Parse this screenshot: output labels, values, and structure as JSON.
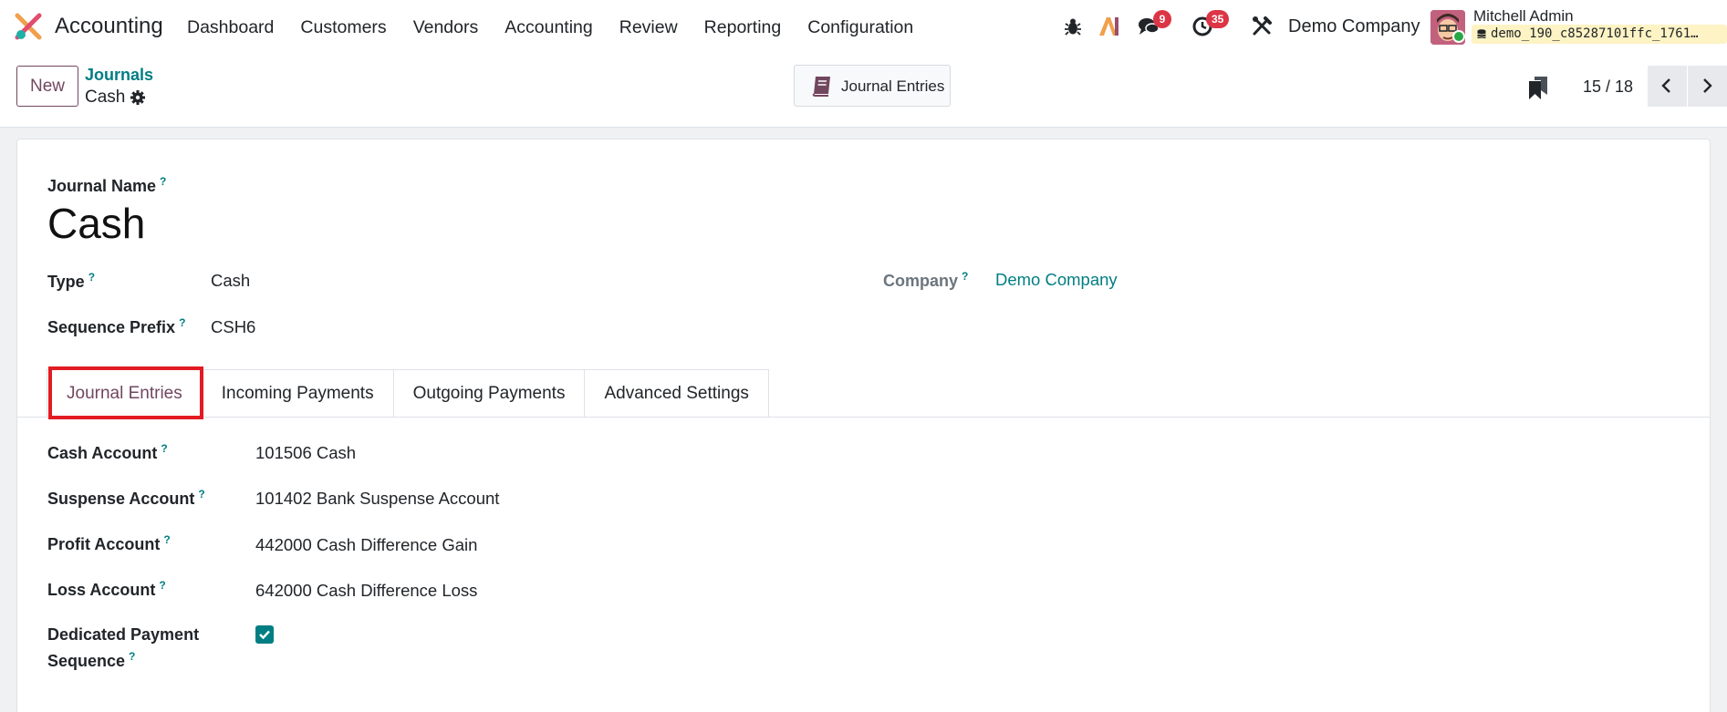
{
  "nav": {
    "app_title": "Accounting",
    "menu": [
      "Dashboard",
      "Customers",
      "Vendors",
      "Accounting",
      "Review",
      "Reporting",
      "Configuration"
    ],
    "messages_badge": "9",
    "activities_badge": "35",
    "company": "Demo Company",
    "user_name": "Mitchell Admin",
    "database": "demo_190_c85287101ffc_1761…",
    "brand_color": "#71475f",
    "link_color": "#017e84"
  },
  "control": {
    "new_label": "New",
    "breadcrumb_parent": "Journals",
    "breadcrumb_current": "Cash",
    "smart_button_label": "Journal Entries",
    "pager": "15 / 18"
  },
  "form": {
    "journal_name_label": "Journal Name",
    "journal_name": "Cash",
    "type_label": "Type",
    "type_value": "Cash",
    "sequence_prefix_label": "Sequence Prefix",
    "sequence_prefix_value": "CSH6",
    "company_label": "Company",
    "company_value": "Demo Company",
    "help_mark": "?"
  },
  "tabs": [
    "Journal Entries",
    "Incoming Payments",
    "Outgoing Payments",
    "Advanced Settings"
  ],
  "active_tab": "Journal Entries",
  "journal_entries": {
    "cash_account_label": "Cash Account",
    "cash_account_value": "101506 Cash",
    "suspense_account_label": "Suspense Account",
    "suspense_account_value": "101402 Bank Suspense Account",
    "profit_account_label": "Profit Account",
    "profit_account_value": "442000 Cash Difference Gain",
    "loss_account_label": "Loss Account",
    "loss_account_value": "642000 Cash Difference Loss",
    "dedicated_payment_label_line1": "Dedicated Payment",
    "dedicated_payment_label_line2": "Sequence",
    "dedicated_payment_checked": true
  }
}
